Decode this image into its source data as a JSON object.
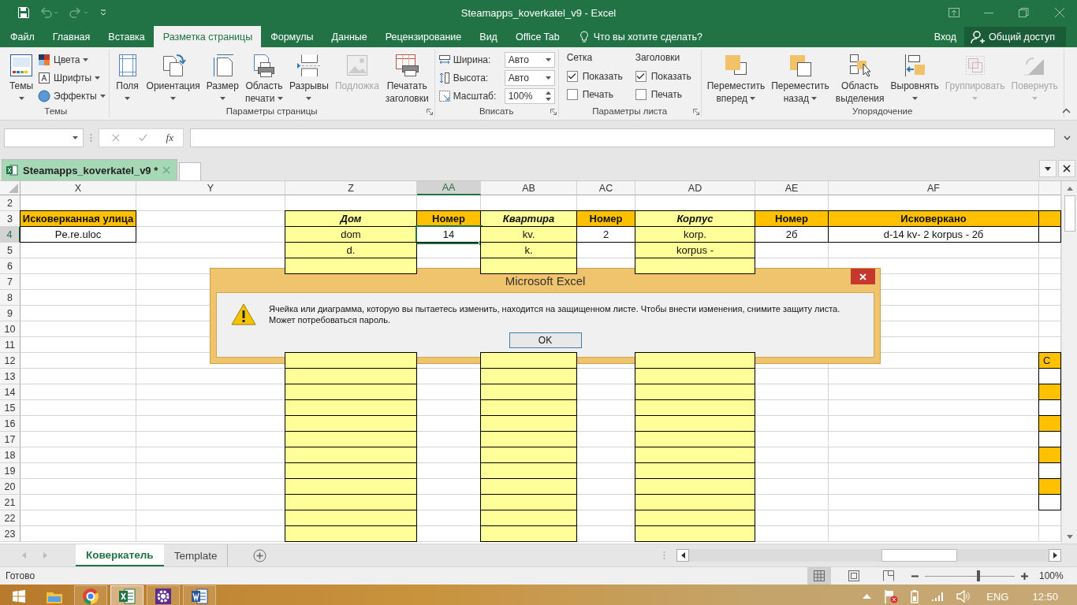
{
  "title_bar": {
    "title": "Steamapps_koverkatel_v9 - Excel"
  },
  "menu_tabs": [
    {
      "label": "Файл",
      "selected": false
    },
    {
      "label": "Главная",
      "selected": false
    },
    {
      "label": "Вставка",
      "selected": false
    },
    {
      "label": "Разметка страницы",
      "selected": true
    },
    {
      "label": "Формулы",
      "selected": false
    },
    {
      "label": "Данные",
      "selected": false
    },
    {
      "label": "Рецензирование",
      "selected": false
    },
    {
      "label": "Вид",
      "selected": false
    },
    {
      "label": "Office Tab",
      "selected": false
    }
  ],
  "tell_me": {
    "placeholder": "Что вы хотите сделать?"
  },
  "sign_in": "Вход",
  "share": "Общий доступ",
  "ribbon": {
    "groups": [
      {
        "label": "Темы",
        "launcher": false,
        "items": [
          {
            "kind": "large",
            "lines": [
              "Темы"
            ],
            "dropdown": true,
            "disabled": false
          },
          {
            "kind": "small",
            "label": "Цвета",
            "dropdown": true
          },
          {
            "kind": "small",
            "label": "Шрифты",
            "dropdown": true
          },
          {
            "kind": "small",
            "label": "Эффекты",
            "dropdown": true
          }
        ]
      },
      {
        "label": "Параметры страницы",
        "launcher": true,
        "items": [
          {
            "kind": "large",
            "lines": [
              "Поля"
            ],
            "dropdown": true,
            "disabled": false
          },
          {
            "kind": "large",
            "lines": [
              "Ориентация"
            ],
            "dropdown": true,
            "disabled": false
          },
          {
            "kind": "large",
            "lines": [
              "Размер"
            ],
            "dropdown": true,
            "disabled": false
          },
          {
            "kind": "large",
            "lines": [
              "Область",
              "печати"
            ],
            "dropdown": true,
            "disabled": false
          },
          {
            "kind": "large",
            "lines": [
              "Разрывы"
            ],
            "dropdown": true,
            "disabled": false
          },
          {
            "kind": "large",
            "lines": [
              "Подложка"
            ],
            "dropdown": false,
            "disabled": true
          },
          {
            "kind": "large",
            "lines": [
              "Печатать",
              "заголовки"
            ],
            "dropdown": false,
            "disabled": false
          }
        ]
      },
      {
        "label": "Вписать",
        "launcher": true,
        "items": [
          {
            "kind": "select",
            "label": "Ширина:",
            "value": "Авто"
          },
          {
            "kind": "select",
            "label": "Высота:",
            "value": "Авто"
          },
          {
            "kind": "spin",
            "label": "Масштаб:",
            "value": "100%"
          }
        ]
      },
      {
        "label": "Параметры листа",
        "launcher": true,
        "items": [
          {
            "kind": "checks",
            "heading": "Сетка",
            "options": [
              {
                "label": "Показать",
                "checked": true
              },
              {
                "label": "Печать",
                "checked": false
              }
            ]
          },
          {
            "kind": "checks",
            "heading": "Заголовки",
            "options": [
              {
                "label": "Показать",
                "checked": true
              },
              {
                "label": "Печать",
                "checked": false
              }
            ]
          }
        ]
      },
      {
        "label": "Упорядочение",
        "launcher": false,
        "items": [
          {
            "kind": "large",
            "lines": [
              "Переместить",
              "вперед"
            ],
            "dropdown": true,
            "disabled": false
          },
          {
            "kind": "large",
            "lines": [
              "Переместить",
              "назад"
            ],
            "dropdown": true,
            "disabled": false
          },
          {
            "kind": "large",
            "lines": [
              "Область",
              "выделения"
            ],
            "dropdown": false,
            "disabled": false
          },
          {
            "kind": "large",
            "lines": [
              "Выровнять"
            ],
            "dropdown": true,
            "disabled": false
          },
          {
            "kind": "large",
            "lines": [
              "Группировать"
            ],
            "dropdown": true,
            "disabled": true
          },
          {
            "kind": "large",
            "lines": [
              "Повернуть"
            ],
            "dropdown": true,
            "disabled": true
          }
        ]
      }
    ]
  },
  "formula_bar": {
    "function_label": "fx"
  },
  "document_tabs": [
    {
      "label": "Steamapps_koverkatel_v9 *",
      "selected": true
    }
  ],
  "sheet": {
    "columns": [
      {
        "label": "X",
        "selected": false
      },
      {
        "label": "Y",
        "selected": false
      },
      {
        "label": "Z",
        "selected": false
      },
      {
        "label": "AA",
        "selected": true
      },
      {
        "label": "AB",
        "selected": false
      },
      {
        "label": "AC",
        "selected": false
      },
      {
        "label": "AD",
        "selected": false
      },
      {
        "label": "AE",
        "selected": false
      },
      {
        "label": "AF",
        "selected": false
      }
    ],
    "rows": [
      {
        "number": "2",
        "selected": false
      },
      {
        "number": "3",
        "selected": false,
        "cells": [
          {
            "kind": "orange-header",
            "text": "Исковерканная улица"
          },
          {
            "kind": "blank"
          },
          {
            "kind": "yellow-header",
            "text": "Дом"
          },
          {
            "kind": "orange-header",
            "text": "Номер"
          },
          {
            "kind": "yellow-header",
            "text": "Квартира"
          },
          {
            "kind": "orange-header",
            "text": "Номер"
          },
          {
            "kind": "yellow-header",
            "text": "Корпус"
          },
          {
            "kind": "orange-header",
            "text": "Номер"
          },
          {
            "kind": "orange-header",
            "text": "Исковеркано"
          },
          {
            "kind": "orange"
          }
        ]
      },
      {
        "number": "4",
        "selected": true,
        "cells": [
          {
            "kind": "bordered",
            "text": "Pe.re.uloc"
          },
          {
            "kind": "blank"
          },
          {
            "kind": "yellow",
            "text": "dom"
          },
          {
            "kind": "bordered",
            "text": "14"
          },
          {
            "kind": "yellow",
            "text": "kv."
          },
          {
            "kind": "bordered",
            "text": "2"
          },
          {
            "kind": "yellow",
            "text": "korp."
          },
          {
            "kind": "bordered",
            "text": "2б"
          },
          {
            "kind": "bordered",
            "text": "d-14 kv- 2 korpus -  2б"
          },
          {
            "kind": "bordered"
          }
        ]
      },
      {
        "number": "5",
        "selected": false,
        "cells": [
          {
            "kind": "blank"
          },
          {
            "kind": "blank"
          },
          {
            "kind": "yellow",
            "text": "d."
          },
          {
            "kind": "blank"
          },
          {
            "kind": "yellow",
            "text": "k."
          },
          {
            "kind": "blank"
          },
          {
            "kind": "yellow",
            "text": "korpus -"
          },
          {
            "kind": "blank"
          },
          {
            "kind": "blank"
          },
          {
            "kind": "blank"
          }
        ]
      },
      {
        "number": "6",
        "selected": false,
        "cells": [
          {
            "kind": "blank"
          },
          {
            "kind": "blank"
          },
          {
            "kind": "yellow"
          },
          {
            "kind": "blank"
          },
          {
            "kind": "yellow"
          },
          {
            "kind": "blank"
          },
          {
            "kind": "yellow"
          },
          {
            "kind": "blank"
          },
          {
            "kind": "blank"
          },
          {
            "kind": "blank"
          }
        ]
      },
      {
        "number": "7",
        "selected": false
      },
      {
        "number": "8",
        "selected": false
      },
      {
        "number": "9",
        "selected": false
      },
      {
        "number": "10",
        "selected": false
      },
      {
        "number": "11",
        "selected": false
      },
      {
        "number": "12",
        "selected": false,
        "cells": [
          {
            "kind": "blank"
          },
          {
            "kind": "blank"
          },
          {
            "kind": "yellow"
          },
          {
            "kind": "blank"
          },
          {
            "kind": "yellow"
          },
          {
            "kind": "blank"
          },
          {
            "kind": "yellow"
          },
          {
            "kind": "blank"
          },
          {
            "kind": "blank"
          },
          {
            "kind": "orange",
            "text": "С"
          }
        ]
      },
      {
        "number": "13",
        "selected": false,
        "cells": [
          {
            "kind": "blank"
          },
          {
            "kind": "blank"
          },
          {
            "kind": "yellow"
          },
          {
            "kind": "blank"
          },
          {
            "kind": "yellow"
          },
          {
            "kind": "blank"
          },
          {
            "kind": "yellow"
          },
          {
            "kind": "blank"
          },
          {
            "kind": "blank"
          },
          {
            "kind": "bordered"
          }
        ]
      },
      {
        "number": "14",
        "selected": false,
        "cells": [
          {
            "kind": "blank"
          },
          {
            "kind": "blank"
          },
          {
            "kind": "yellow"
          },
          {
            "kind": "blank"
          },
          {
            "kind": "yellow"
          },
          {
            "kind": "blank"
          },
          {
            "kind": "yellow"
          },
          {
            "kind": "blank"
          },
          {
            "kind": "blank"
          },
          {
            "kind": "orange"
          }
        ]
      },
      {
        "number": "15",
        "selected": false,
        "cells": [
          {
            "kind": "blank"
          },
          {
            "kind": "blank"
          },
          {
            "kind": "yellow"
          },
          {
            "kind": "blank"
          },
          {
            "kind": "yellow"
          },
          {
            "kind": "blank"
          },
          {
            "kind": "yellow"
          },
          {
            "kind": "blank"
          },
          {
            "kind": "blank"
          },
          {
            "kind": "bordered"
          }
        ]
      },
      {
        "number": "16",
        "selected": false,
        "cells": [
          {
            "kind": "blank"
          },
          {
            "kind": "blank"
          },
          {
            "kind": "yellow"
          },
          {
            "kind": "blank"
          },
          {
            "kind": "yellow"
          },
          {
            "kind": "blank"
          },
          {
            "kind": "yellow"
          },
          {
            "kind": "blank"
          },
          {
            "kind": "blank"
          },
          {
            "kind": "orange"
          }
        ]
      },
      {
        "number": "17",
        "selected": false,
        "cells": [
          {
            "kind": "blank"
          },
          {
            "kind": "blank"
          },
          {
            "kind": "yellow"
          },
          {
            "kind": "blank"
          },
          {
            "kind": "yellow"
          },
          {
            "kind": "blank"
          },
          {
            "kind": "yellow"
          },
          {
            "kind": "blank"
          },
          {
            "kind": "blank"
          },
          {
            "kind": "bordered"
          }
        ]
      },
      {
        "number": "18",
        "selected": false,
        "cells": [
          {
            "kind": "blank"
          },
          {
            "kind": "blank"
          },
          {
            "kind": "yellow"
          },
          {
            "kind": "blank"
          },
          {
            "kind": "yellow"
          },
          {
            "kind": "blank"
          },
          {
            "kind": "yellow"
          },
          {
            "kind": "blank"
          },
          {
            "kind": "blank"
          },
          {
            "kind": "orange"
          }
        ]
      },
      {
        "number": "19",
        "selected": false,
        "cells": [
          {
            "kind": "blank"
          },
          {
            "kind": "blank"
          },
          {
            "kind": "yellow"
          },
          {
            "kind": "blank"
          },
          {
            "kind": "yellow"
          },
          {
            "kind": "blank"
          },
          {
            "kind": "yellow"
          },
          {
            "kind": "blank"
          },
          {
            "kind": "blank"
          },
          {
            "kind": "bordered"
          }
        ]
      },
      {
        "number": "20",
        "selected": false,
        "cells": [
          {
            "kind": "blank"
          },
          {
            "kind": "blank"
          },
          {
            "kind": "yellow"
          },
          {
            "kind": "blank"
          },
          {
            "kind": "yellow"
          },
          {
            "kind": "blank"
          },
          {
            "kind": "yellow"
          },
          {
            "kind": "blank"
          },
          {
            "kind": "blank"
          },
          {
            "kind": "orange"
          }
        ]
      },
      {
        "number": "21",
        "selected": false,
        "cells": [
          {
            "kind": "blank"
          },
          {
            "kind": "blank"
          },
          {
            "kind": "yellow"
          },
          {
            "kind": "blank"
          },
          {
            "kind": "yellow"
          },
          {
            "kind": "blank"
          },
          {
            "kind": "yellow"
          },
          {
            "kind": "blank"
          },
          {
            "kind": "blank"
          },
          {
            "kind": "bordered"
          }
        ]
      },
      {
        "number": "22",
        "selected": false,
        "cells": [
          {
            "kind": "blank"
          },
          {
            "kind": "blank"
          },
          {
            "kind": "yellow"
          },
          {
            "kind": "blank"
          },
          {
            "kind": "yellow"
          },
          {
            "kind": "blank"
          },
          {
            "kind": "yellow"
          },
          {
            "kind": "blank"
          },
          {
            "kind": "blank"
          },
          {
            "kind": "blank"
          }
        ]
      },
      {
        "number": "23",
        "selected": false,
        "cells": [
          {
            "kind": "blank"
          },
          {
            "kind": "blank"
          },
          {
            "kind": "yellow"
          },
          {
            "kind": "blank"
          },
          {
            "kind": "yellow"
          },
          {
            "kind": "blank"
          },
          {
            "kind": "yellow"
          },
          {
            "kind": "blank"
          },
          {
            "kind": "blank"
          },
          {
            "kind": "blank"
          }
        ]
      }
    ]
  },
  "dialog": {
    "title": "Microsoft Excel",
    "message": "Ячейка или диаграмма, которую вы пытаетесь изменить, находится на защищенном листе. Чтобы внести изменения, снимите защиту листа. Может потребоваться пароль.",
    "button": "OK"
  },
  "sheet_tabs": [
    {
      "label": "Коверкатель",
      "selected": true
    },
    {
      "label": "Template",
      "selected": false
    }
  ],
  "status_bar": {
    "text": "Готово",
    "views": [
      {
        "selected": true
      },
      {
        "selected": false
      },
      {
        "selected": false
      }
    ],
    "zoom": {
      "level": 0.6,
      "reading": "100%"
    }
  },
  "taskbar": {
    "apps": [
      {
        "selected": false
      },
      {
        "selected": false
      },
      {
        "selected": true
      },
      {
        "selected": false
      },
      {
        "selected": false
      }
    ],
    "language": "ENG",
    "time": "12:50"
  }
}
